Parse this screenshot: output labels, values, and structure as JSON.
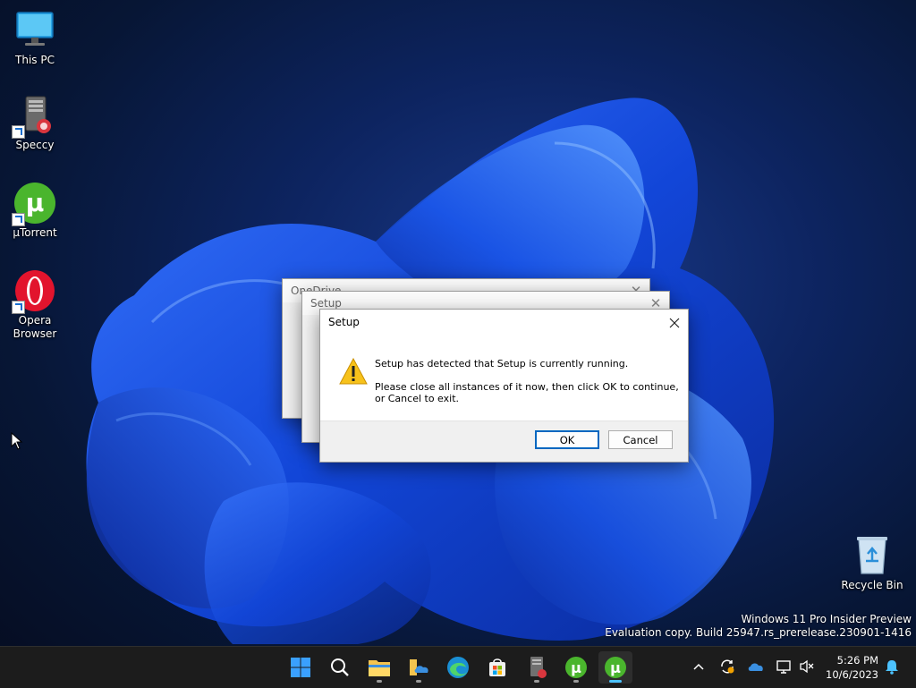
{
  "desktop": {
    "icons": [
      {
        "label": "This PC"
      },
      {
        "label": "Speccy"
      },
      {
        "label": "µTorrent"
      },
      {
        "label": "Opera Browser"
      },
      {
        "label": "Recycle Bin"
      }
    ]
  },
  "back_windows": [
    {
      "title": "OneDrive"
    },
    {
      "title": "Setup"
    }
  ],
  "dialog": {
    "title": "Setup",
    "icon": "warning-icon",
    "message_line1": "Setup has detected that Setup is currently running.",
    "message_line2": "Please close all instances of it now, then click OK to continue, or Cancel to exit.",
    "ok_label": "OK",
    "cancel_label": "Cancel",
    "accent": "#0067c0"
  },
  "watermark": {
    "line1": "Windows 11 Pro Insider Preview",
    "line2": "Evaluation copy. Build 25947.rs_prerelease.230901-1416"
  },
  "taskbar": {
    "apps": [
      "start-icon",
      "search-icon",
      "file-explorer-icon",
      "onedrive-folder-icon",
      "edge-icon",
      "store-icon",
      "speccy-icon",
      "utorrent-icon",
      "utorrent-icon"
    ],
    "tray": [
      "chevron-up-icon",
      "sync-icon",
      "onedrive-cloud-icon",
      "network-icon",
      "volume-muted-icon"
    ],
    "time": "5:26 PM",
    "date": "10/6/2023"
  }
}
